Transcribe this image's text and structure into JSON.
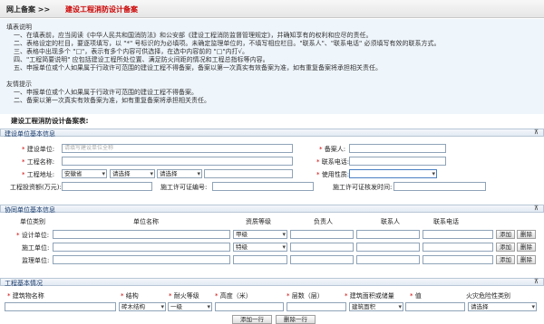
{
  "top": {
    "title1": "网上备案 >>",
    "title2": "建设工程消防设计备案"
  },
  "instructions": {
    "heading": "填表说明",
    "lines": [
      "一、在填表前，应当阅读《中华人民共和国消防法》和公安部《建设工程消防监督管理规定》，并确知享有的权利和应尽的责任。",
      "二、表格设定的栏目，要逐项填写，以 \"*\" 号标识的为必填项。未确定监理单位的，不填写相应栏目。\"联系人\"、\"联系电话\" 必须填写有效的联系方式。",
      "三、表格中出现多个 \"□\"，表示有多个内容可供选择，在选中内容前的 \"□\"内打√。",
      "四、\"工程简要说明\" 应包括建设工程所处位置、满足防火间距的情况和工程总指标等内容。",
      "五、申报单位或个人如果属于行政许可范围的建设工程不得备案，备案以第一次真实有效备案为准，如有重复备案将承担相关责任。"
    ],
    "tips_heading": "友情提示",
    "tips": [
      "一、申报单位或个人如果属于行政许可范围的建设工程不得备案。",
      "二、备案以第一次真实有效备案为准，如有重复备案将承担相关责任。"
    ],
    "form_title": "建设工程消防设计备案表:"
  },
  "sec1": {
    "title": "建设单位基本信息",
    "collapse": "⊼",
    "unit_label": "建设单位:",
    "unit_placeholder": "请填写建设单位全称",
    "filer_label": "备案人:",
    "project_label": "工程名称:",
    "phone_label": "联系电话:",
    "addr_label": "工程地址:",
    "province": "安徽省",
    "city": "请选择",
    "district": "请选择",
    "use_label": "使用性质:",
    "invest_label": "工程投资额(万元):",
    "permit_no_label": "施工许可证编号:",
    "permit_date_label": "施工许可证核发时间:"
  },
  "sec2": {
    "title": "协同单位基本信息",
    "collapse": "⊼",
    "cols": [
      "单位类别",
      "单位名称",
      "资质等级",
      "负责人",
      "联系人",
      "联系电话"
    ],
    "rows": [
      {
        "label": "设计单位:",
        "grade": "甲级",
        "req": true
      },
      {
        "label": "施工单位:",
        "grade": "特级",
        "req": false
      },
      {
        "label": "监理单位:",
        "grade": "",
        "req": false
      }
    ],
    "add": "添加",
    "del": "删除"
  },
  "sec3": {
    "title": "工程基本情况",
    "collapse": "⊼",
    "cols": [
      "建筑物名称",
      "结构",
      "耐火等级",
      "高度（米）",
      "层数（层）",
      "建筑面积或储量",
      "值",
      "火灾危险性类别"
    ],
    "struct": "砖木结构",
    "fire": "一级",
    "area": "建筑面积",
    "risk": "请选择",
    "add_row": "添加一行",
    "del_row": "删除一行"
  }
}
